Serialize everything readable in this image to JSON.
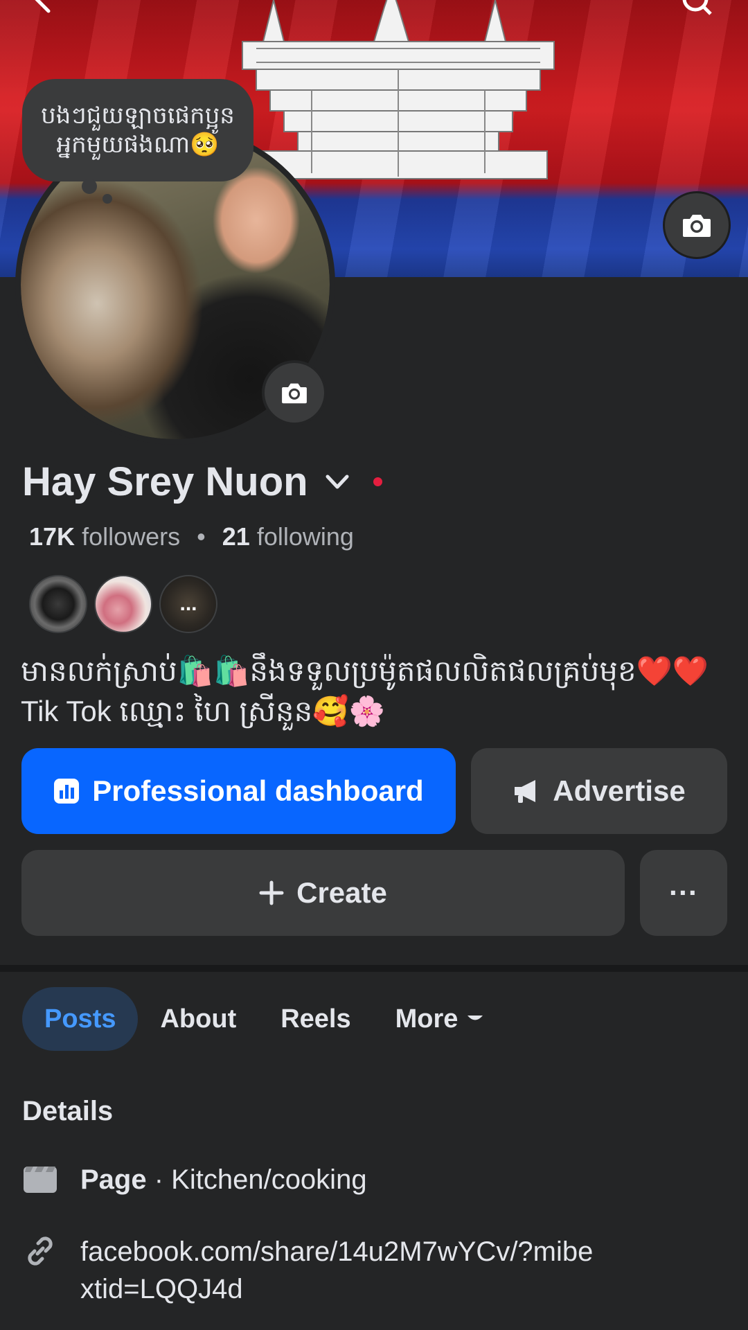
{
  "cover": {
    "camera_icon": "camera-icon",
    "back_icon": "back-arrow-icon",
    "search_icon": "search-icon"
  },
  "avatar": {
    "note_bubble": "បងៗជួយឡាចផេកប្អូនអ្នកមួយផងណា🥺",
    "camera_icon": "camera-icon"
  },
  "profile": {
    "name": "Hay Srey Nuon",
    "followers_count": "17K",
    "followers_label": "followers",
    "separator": "•",
    "following_count": "21",
    "following_label": "following",
    "friends_more": "...",
    "bio": "មានលក់ស្រាប់🛍️🛍️នឹងទទួលប្រម៉ូតផលលិតផលគ្រប់មុខ❤️❤️Tik Tok ឈ្មោះ ហៃ ស្រីនួន🥰🌸"
  },
  "actions": {
    "dashboard_label": "Professional dashboard",
    "advertise_label": "Advertise",
    "create_label": "Create",
    "more_label": "···"
  },
  "tabs": [
    {
      "label": "Posts",
      "active": true
    },
    {
      "label": "About",
      "active": false
    },
    {
      "label": "Reels",
      "active": false
    },
    {
      "label": "More",
      "active": false
    }
  ],
  "details": {
    "title": "Details",
    "page_type_bold": "Page",
    "page_type_rest": " · Kitchen/cooking",
    "link": "facebook.com/share/14u2M7wYCv/?mibextid=LQQJ4d"
  },
  "colors": {
    "background": "#242526",
    "primary_button": "#0866ff",
    "secondary_button": "#3a3b3c",
    "active_tab_bg": "#263951",
    "active_tab_text": "#4599ff",
    "notification_dot": "#e41e3f"
  }
}
